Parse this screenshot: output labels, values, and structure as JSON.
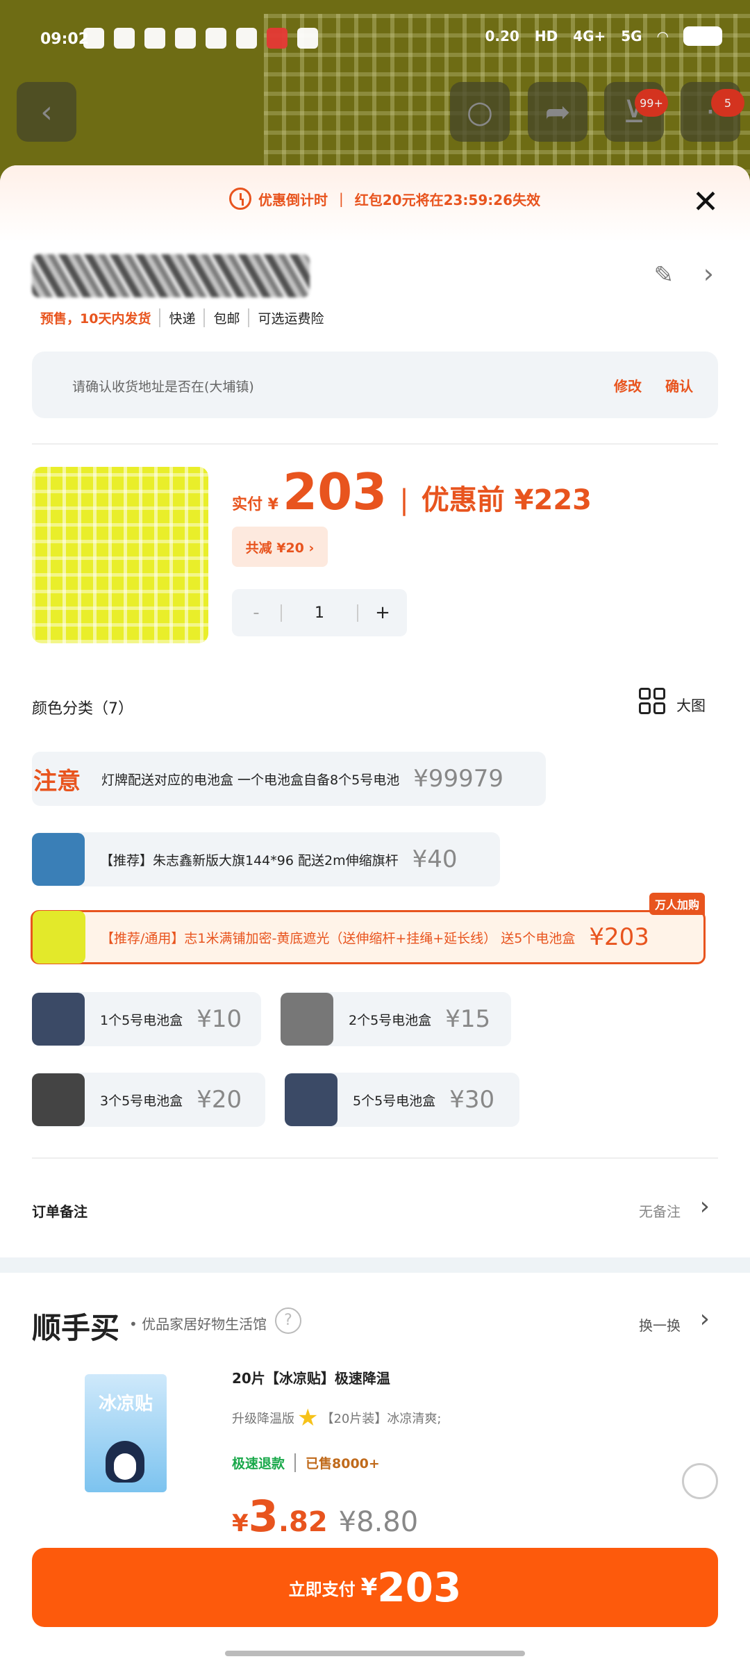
{
  "status": {
    "time": "09:02",
    "net": "0.20",
    "signal1": "4G+",
    "signal2": "5G",
    "hd": "HD"
  },
  "nav": {
    "cart_badge": "99+",
    "more_badge": "5"
  },
  "countdown": {
    "label": "优惠倒计时",
    "sep": "|",
    "text": "红包20元将在23:59:26失效"
  },
  "shipping": [
    "预售，10天内发货",
    "快递",
    "包邮",
    "可选运费险"
  ],
  "address_confirm": {
    "text": "请确认收货地址是否在(大埔镇)",
    "edit": "修改",
    "ok": "确认"
  },
  "product": {
    "pay_label": "实付 ¥",
    "price": "203",
    "sep": "|",
    "orig_label": "优惠前 ¥223",
    "discount": "共减 ¥20 ›",
    "qty": "1",
    "minus": "-",
    "plus": "+"
  },
  "category": {
    "title": "颜色分类（7）",
    "bigview": "大图"
  },
  "options": [
    {
      "lead": "注意",
      "text": "灯牌配送对应的电池盒   一个电池盒自备8个5号电池",
      "price": "¥99979"
    },
    {
      "text": "【推荐】朱志鑫新版大旗144*96   配送2m伸缩旗杆",
      "price": "¥40"
    },
    {
      "text": "【推荐/通用】志1米满铺加密-黄底遮光（送伸缩杆+挂绳+延长线）   送5个电池盒",
      "price": "¥203",
      "tag": "万人加购"
    },
    {
      "text": "1个5号电池盒",
      "price": "¥10"
    },
    {
      "text": "2个5号电池盒",
      "price": "¥15"
    },
    {
      "text": "3个5号电池盒",
      "price": "¥20"
    },
    {
      "text": "5个5号电池盒",
      "price": "¥30"
    }
  ],
  "remark": {
    "label": "订单备注",
    "value": "无备注"
  },
  "recommend": {
    "brand": "顺手买",
    "subtitle": "• 优品家居好物生活馆",
    "help": "?",
    "swap": "换一换",
    "img_text": "冰凉贴",
    "title": "20片【冰凉贴】极速降温",
    "sub1": "升级降温版",
    "sub2": "【20片装】冰凉清爽;",
    "tag1": "极速退款",
    "tag2": "已售8000+",
    "cur": "¥",
    "price_int": "3",
    "price_dec": ".82",
    "old_price": "¥8.80"
  },
  "pay": {
    "label": "立即支付",
    "cur": "¥",
    "value": "203"
  }
}
